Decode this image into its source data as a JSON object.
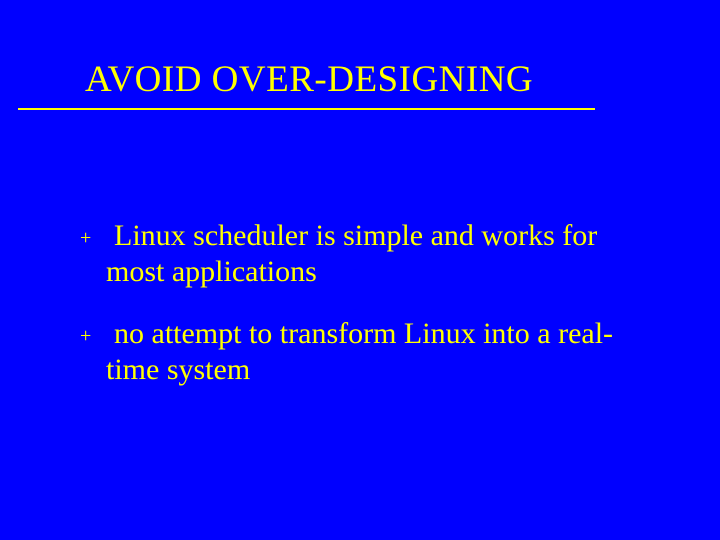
{
  "title": "AVOID OVER-DESIGNING",
  "bullets": {
    "glyph": "+",
    "items": [
      "Linux scheduler is simple and works for most applications",
      "no attempt to transform Linux into a real-time system"
    ]
  }
}
